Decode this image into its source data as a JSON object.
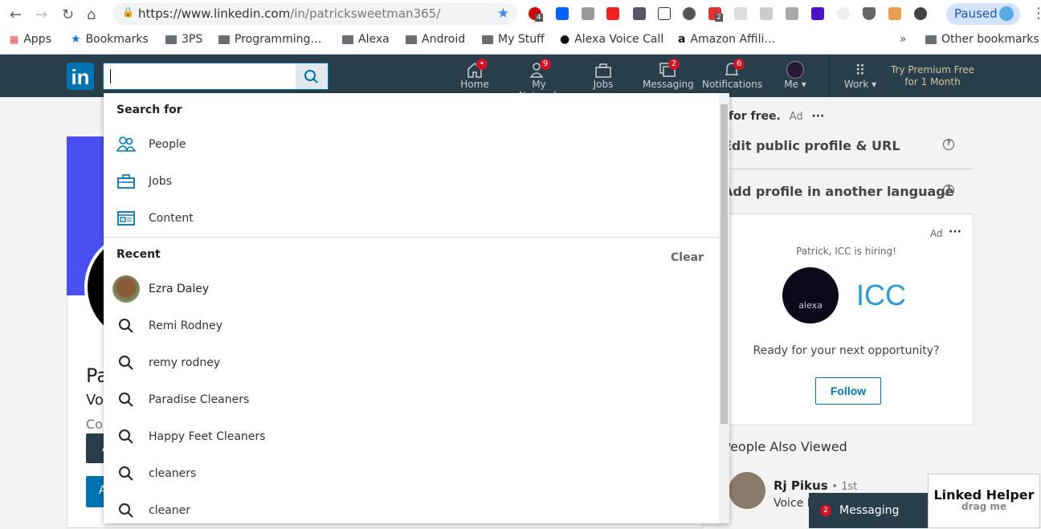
{
  "browser": {
    "url_host": "https://www.linkedin.com",
    "url_path": "/in/patricksweetman365/",
    "ext_badges": {
      "abp": "4",
      "ext2": "2"
    },
    "paused_label": "Paused",
    "bookmarks": [
      "Apps",
      "Bookmarks",
      "3PS",
      "Programming…",
      "Alexa",
      "Android",
      "My Stuff",
      "Alexa Voice Call",
      "Amazon Affili…"
    ],
    "overflow": "»",
    "other_bookmarks": "Other bookmarks"
  },
  "nav": {
    "logo": "in",
    "search_value": "",
    "items": [
      {
        "label": "Home",
        "badge": "•"
      },
      {
        "label": "My Network",
        "badge": "9"
      },
      {
        "label": "Jobs",
        "badge": ""
      },
      {
        "label": "Messaging",
        "badge": "2"
      },
      {
        "label": "Notifications",
        "badge": "6"
      },
      {
        "label": "Me ▾",
        "badge": ""
      },
      {
        "label": "Work ▾",
        "badge": ""
      }
    ],
    "premium": "Try Premium Free for 1 Month"
  },
  "dropdown": {
    "search_for_title": "Search for",
    "search_for": [
      "People",
      "Jobs",
      "Content"
    ],
    "recent_title": "Recent",
    "clear_label": "Clear",
    "recent": [
      "Ezra Daley",
      "Remi Rodney",
      "remy rodney",
      "Paradise Cleaners",
      "Happy Feet Cleaners",
      "cleaners",
      "cleaner"
    ]
  },
  "profile": {
    "name_partial": "Pa",
    "headline_partial": "Vo",
    "location_partial": "Col",
    "btn1_partial": "A",
    "btn2_partial": "A"
  },
  "right": {
    "promo": "for free.",
    "ad": "Ad",
    "more": "···",
    "edit_profile": "Edit public profile & URL",
    "add_language": "Add profile in another language",
    "ad_card": {
      "ad": "Ad",
      "more": "···",
      "hiring": "Patrick, ICC is hiring!",
      "company_logo": "ICC",
      "avatar_text": "alexa",
      "question": "Ready for your next opportunity?",
      "follow": "Follow"
    },
    "people_also_viewed": "People Also Viewed",
    "person": {
      "name": "Rj Pikus",
      "degree": "• 1st",
      "headline_partial": "Voice F"
    }
  },
  "messaging": {
    "badge": "2",
    "label": "Messaging"
  },
  "linked_helper": {
    "title": "Linked Helper",
    "sub": "drag me"
  },
  "colors": {
    "nav": "#283e4a",
    "brand": "#0073b1",
    "banner": "#4a4ff0",
    "badge": "#d11124"
  }
}
